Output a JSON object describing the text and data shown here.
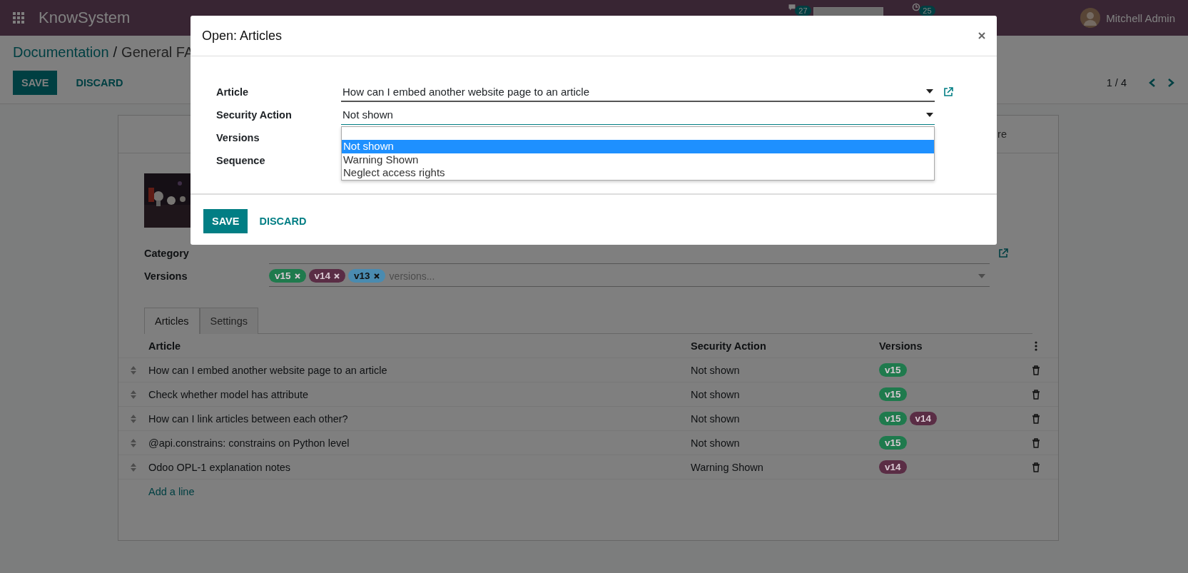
{
  "navbar": {
    "app_name": "KnowSystem",
    "chat_count": "27",
    "activity_count": "25",
    "user": "Mitchell Admin"
  },
  "breadcrumb": {
    "items": [
      "Documentation",
      "General FA"
    ],
    "separator": "/"
  },
  "buttons": [
    "SAVE",
    "DISCARD"
  ],
  "pager": "1 / 4",
  "sheet": {
    "header_text": "re",
    "fields": [
      {
        "label": "Category"
      },
      {
        "label": "Versions",
        "tags": [
          {
            "label": "v15",
            "color": "#1f7a4d"
          },
          {
            "label": "v14",
            "color": "#5a2d45"
          },
          {
            "label": "v13",
            "color": "#4a8bb0"
          }
        ],
        "placeholder": "versions..."
      }
    ],
    "tabs": [
      {
        "label": "Articles",
        "selected": true
      },
      {
        "label": "Settings",
        "selected": false
      }
    ],
    "table": {
      "columns": [
        "Article",
        "Security Action",
        "Versions"
      ],
      "rows": [
        {
          "article": "How can I embed another website page to an article",
          "security": "Not shown",
          "versions": [
            {
              "label": "v15",
              "color": "#1f7a4d"
            }
          ]
        },
        {
          "article": "Check whether model has attribute",
          "security": "Not shown",
          "versions": [
            {
              "label": "v15",
              "color": "#1f7a4d"
            }
          ]
        },
        {
          "article": "How can I link articles between each other?",
          "security": "Not shown",
          "versions": [
            {
              "label": "v15",
              "color": "#1f7a4d"
            },
            {
              "label": "v14",
              "color": "#5a2d45"
            }
          ]
        },
        {
          "article": "@api.constrains: constrains on Python level",
          "security": "Not shown",
          "versions": [
            {
              "label": "v15",
              "color": "#1f7a4d"
            }
          ]
        },
        {
          "article": "Odoo OPL-1 explanation notes",
          "security": "Warning Shown",
          "versions": [
            {
              "label": "v14",
              "color": "#5a2d45"
            }
          ]
        }
      ],
      "add_line": "Add a line"
    }
  },
  "dialog": {
    "title": "Open: Articles",
    "fields": [
      {
        "label": "Article",
        "value": "How can I embed another website page to an article",
        "kind": "many2one"
      },
      {
        "label": "Security Action",
        "value": "Not shown",
        "kind": "selection",
        "options": [
          {
            "label": "Not shown",
            "selected": true
          },
          {
            "label": "Warning Shown",
            "selected": false
          },
          {
            "label": "Neglect access rights",
            "selected": false
          }
        ]
      },
      {
        "label": "Versions",
        "kind": "hidden"
      },
      {
        "label": "Sequence",
        "kind": "hidden"
      }
    ],
    "buttons": [
      "SAVE",
      "DISCARD"
    ]
  }
}
